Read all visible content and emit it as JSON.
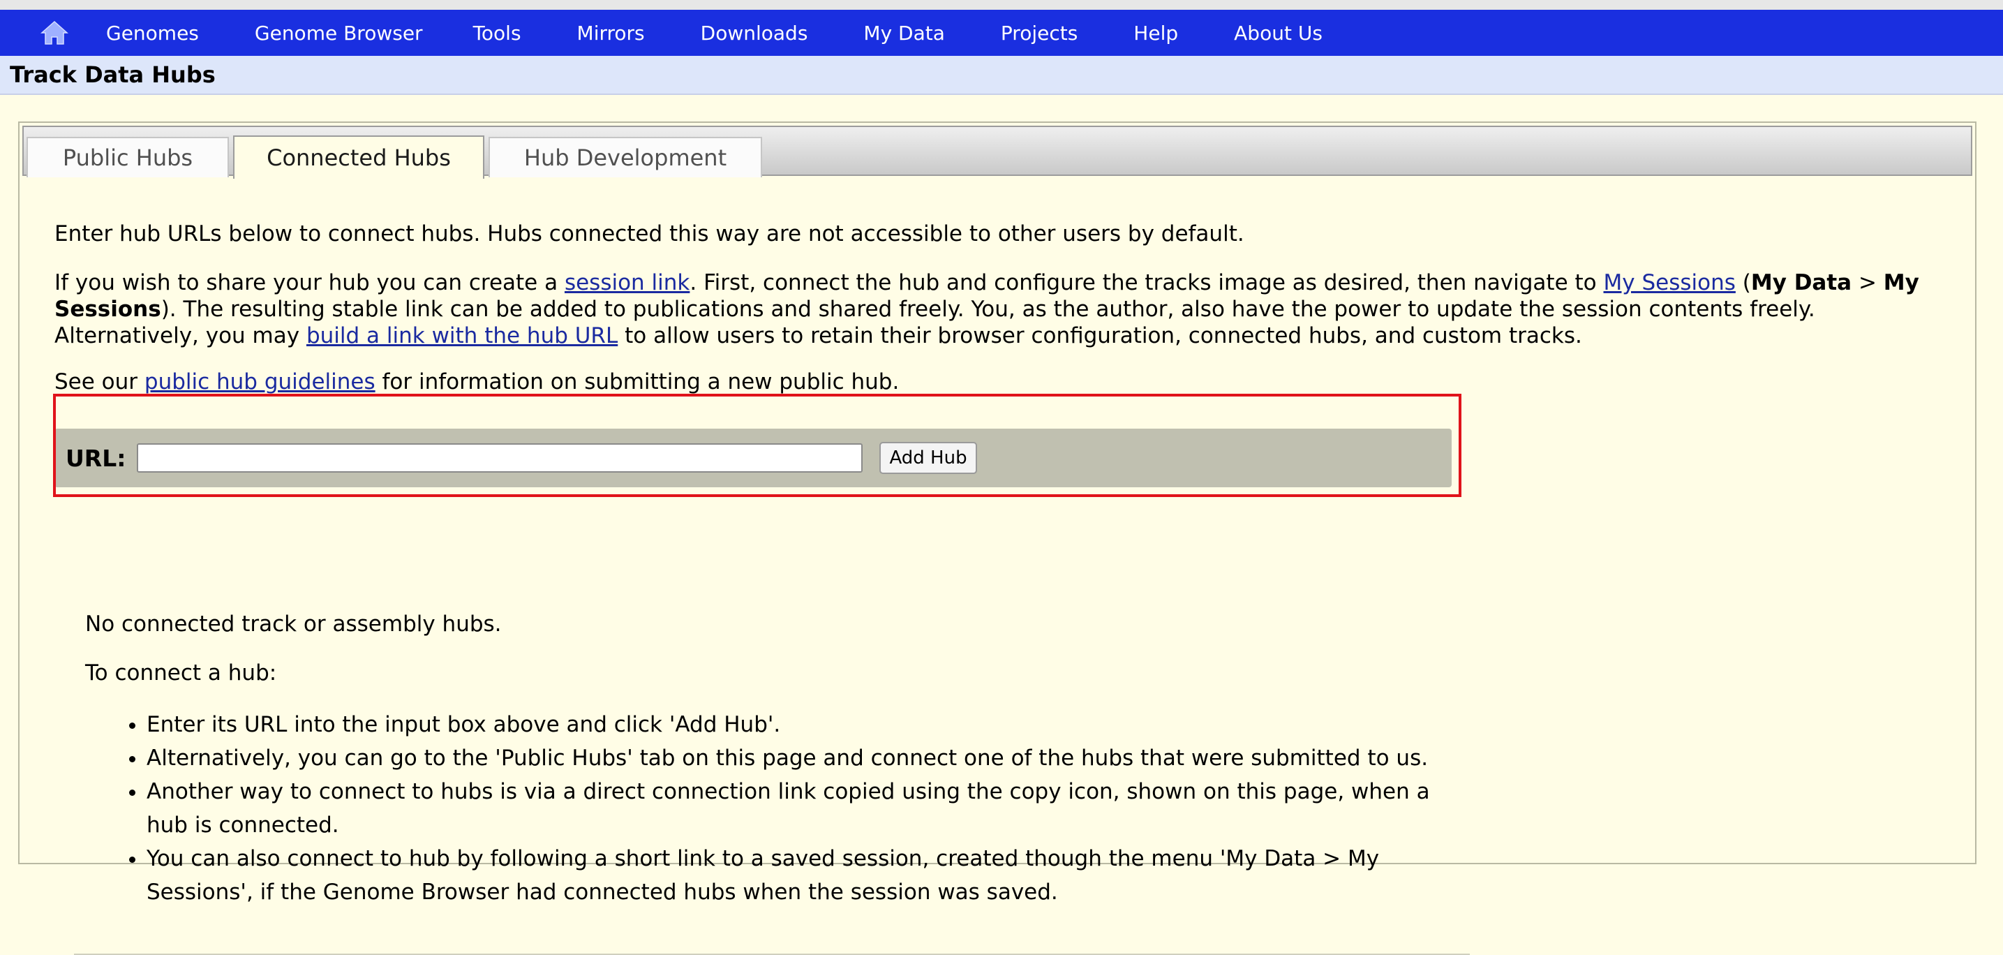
{
  "nav": {
    "home_icon": "home-icon",
    "items": [
      "Genomes",
      "Genome Browser",
      "Tools",
      "Mirrors",
      "Downloads",
      "My Data",
      "Projects",
      "Help",
      "About Us"
    ]
  },
  "page_title": "Track Data Hubs",
  "tabs": [
    {
      "label": "Public Hubs",
      "active": false
    },
    {
      "label": "Connected Hubs",
      "active": true
    },
    {
      "label": "Hub Development",
      "active": false
    }
  ],
  "intro": "Enter hub URLs below to connect hubs. Hubs connected this way are not accessible to other users by default.",
  "share": {
    "t1": "If you wish to share your hub you can create a ",
    "session_link": "session link",
    "t2": ". First, connect the hub and configure the tracks image as desired, then navigate to ",
    "my_sessions_link": "My Sessions",
    "t3": " (",
    "bold1": "My Data",
    "t4": " > ",
    "bold2": "My Sessions",
    "t5": "). The resulting stable link can be added to publications and shared freely. You, as the author, also have the power to update the session contents freely. Alternatively, you may ",
    "build_link": "build a link with the hub URL",
    "t6": " to allow users to retain their browser configuration, connected hubs, and custom tracks."
  },
  "guidelines": {
    "t1": "See our ",
    "link": "public hub guidelines",
    "t2": " for information on submitting a new public hub."
  },
  "url_form": {
    "label": "URL:",
    "value": "",
    "button": "Add Hub"
  },
  "no_connected": "No connected track or assembly hubs.",
  "how_to": "To connect a hub:",
  "steps": [
    "Enter its URL into the input box above and click 'Add Hub'.",
    "Alternatively, you can go to the 'Public Hubs' tab on this page and connect one of the hubs that were submitted to us.",
    "Another way to connect to hubs is via a direct connection link copied using the copy icon, shown on this page, when a hub is connected.",
    "You can also connect to hub by following a short link to a saved session, created though the menu 'My Data > My Sessions', if the Genome Browser had connected hubs when the session was saved."
  ],
  "colors": {
    "nav_bg": "#1a2fe0",
    "title_bg": "#dde6fa",
    "page_bg": "#fffde6",
    "highlight": "#e0131a"
  }
}
